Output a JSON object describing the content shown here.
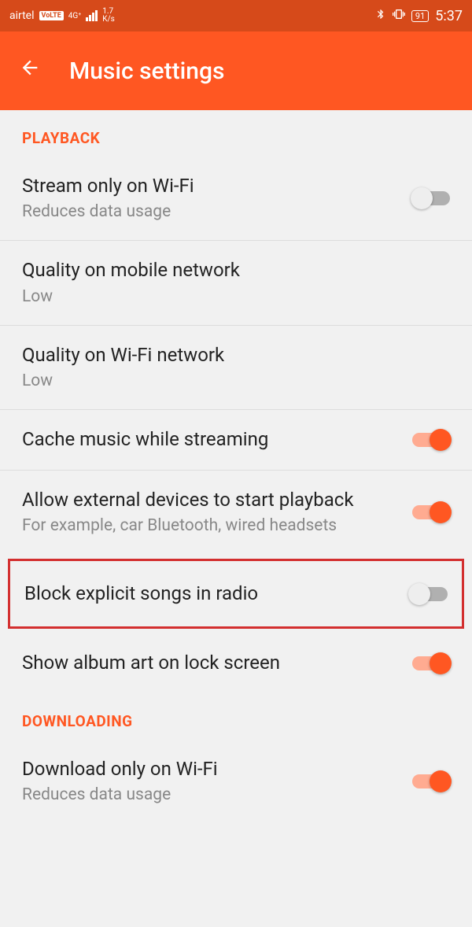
{
  "status": {
    "carrier": "airtel",
    "volte": "VoLTE",
    "net": "4G⁺",
    "speed_top": "1.7",
    "speed_bot": "K/s",
    "battery": "91",
    "time": "5:37"
  },
  "header": {
    "title": "Music settings"
  },
  "sections": {
    "playback": "PLAYBACK",
    "downloading": "DOWNLOADING"
  },
  "rows": {
    "stream_wifi": {
      "title": "Stream only on Wi-Fi",
      "sub": "Reduces data usage"
    },
    "quality_mobile": {
      "title": "Quality on mobile network",
      "sub": "Low"
    },
    "quality_wifi": {
      "title": "Quality on Wi-Fi network",
      "sub": "Low"
    },
    "cache": {
      "title": "Cache music while streaming"
    },
    "external": {
      "title": "Allow external devices to start playback",
      "sub": "For example, car Bluetooth, wired headsets"
    },
    "block_explicit": {
      "title": "Block explicit songs in radio"
    },
    "album_art": {
      "title": "Show album art on lock screen"
    },
    "download_wifi": {
      "title": "Download only on Wi-Fi",
      "sub": "Reduces data usage"
    }
  }
}
